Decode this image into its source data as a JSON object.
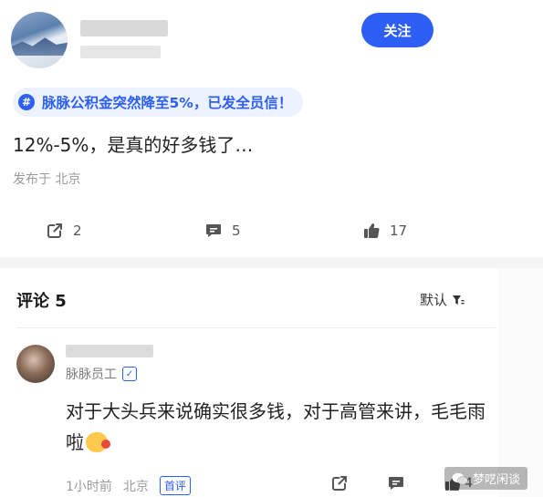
{
  "post": {
    "follow_label": "关注",
    "topic": "脉脉公积金突然降至5%，已发全员信！",
    "content": "12%-5%，是真的好多钱了…",
    "location": "发布于 北京",
    "actions": {
      "share_count": "2",
      "comment_count": "5",
      "like_count": "17"
    }
  },
  "comments": {
    "title": "评论 5",
    "sort_label": "默认",
    "items": [
      {
        "user_title": "脉脉员工",
        "text": "对于大头兵来说确实很多钱，对于高管来讲，毛毛雨啦",
        "time": "1小时前",
        "location": "北京",
        "badge": "首评",
        "like_count": "4"
      }
    ]
  },
  "watermark": "梦呓闲谈",
  "colors": {
    "accent": "#2d5ff5",
    "tag_bg": "#edf2ff",
    "muted": "#9a9a9a"
  },
  "icons": [
    "share-icon",
    "comment-icon",
    "thumbs-up-icon",
    "filter-icon",
    "verified-icon",
    "wechat-icon"
  ]
}
